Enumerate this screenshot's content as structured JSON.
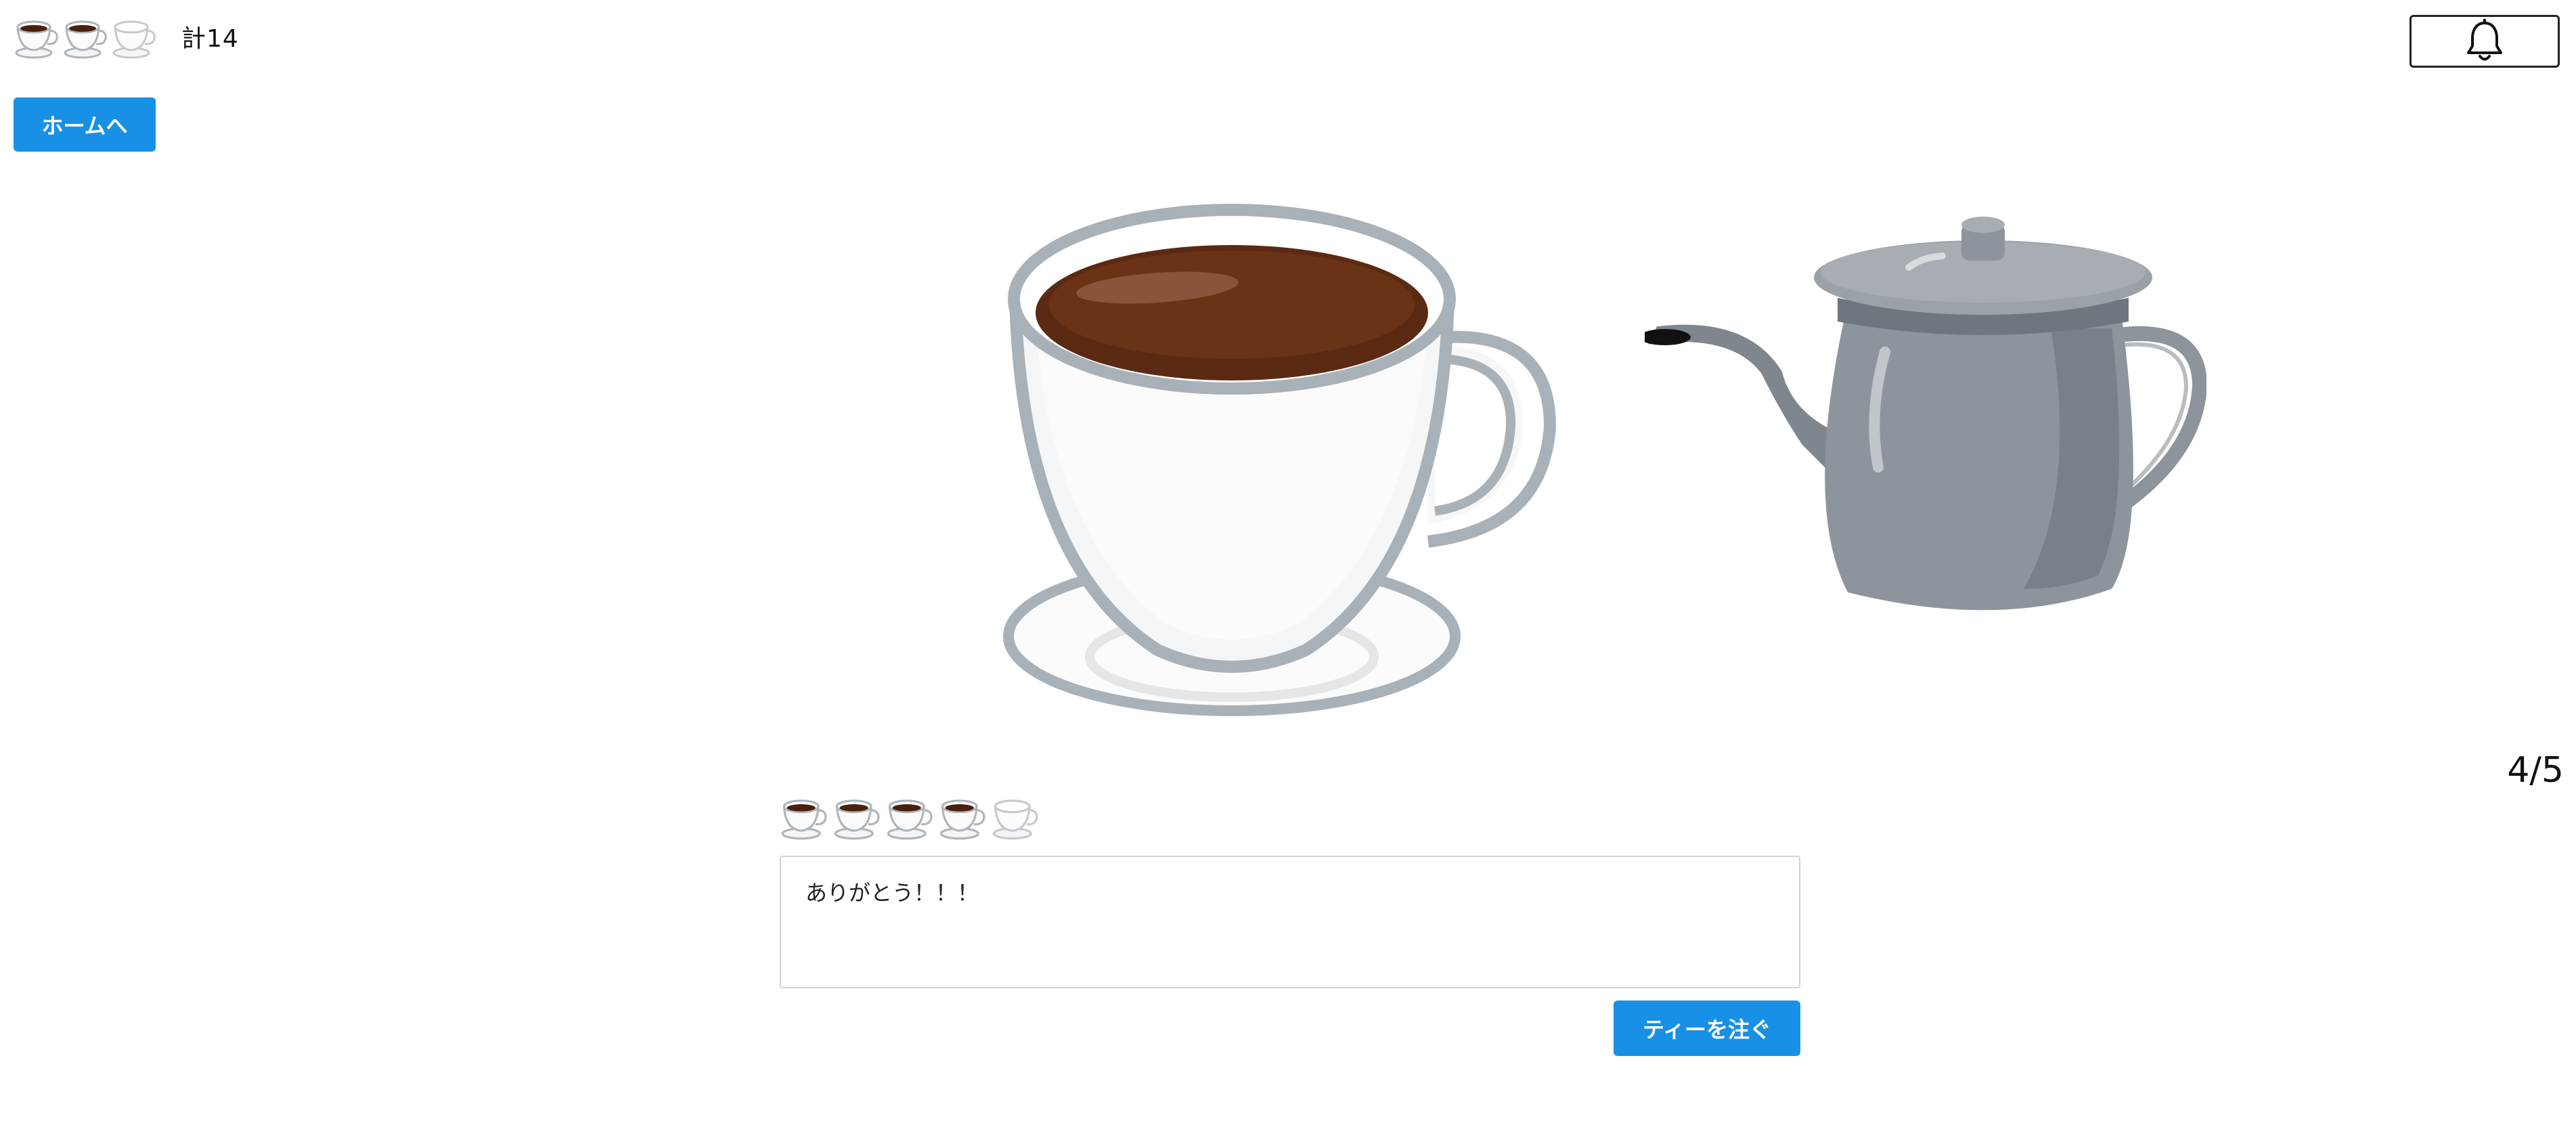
{
  "header": {
    "cups": [
      {
        "icon": "coffee-cup-full-icon"
      },
      {
        "icon": "coffee-cup-full-icon"
      },
      {
        "icon": "coffee-cup-empty-icon"
      }
    ],
    "total_label": "計14",
    "bell_icon": "bell-icon"
  },
  "nav": {
    "home_label": "ホームへ"
  },
  "illustration": {
    "cup_icon": "coffee-cup-illustration",
    "pot_icon": "coffee-pot-illustration"
  },
  "pager": {
    "indicator": "4/5"
  },
  "rating": {
    "value": 4,
    "max": 5
  },
  "comment": {
    "value": "ありがとう！！！"
  },
  "actions": {
    "pour_label": "ティーを注ぐ"
  },
  "colors": {
    "accent": "#1890e6",
    "coffee": "#5a2a12",
    "cup_outline": "#a9b1b8",
    "pot_body": "#8d949b"
  }
}
